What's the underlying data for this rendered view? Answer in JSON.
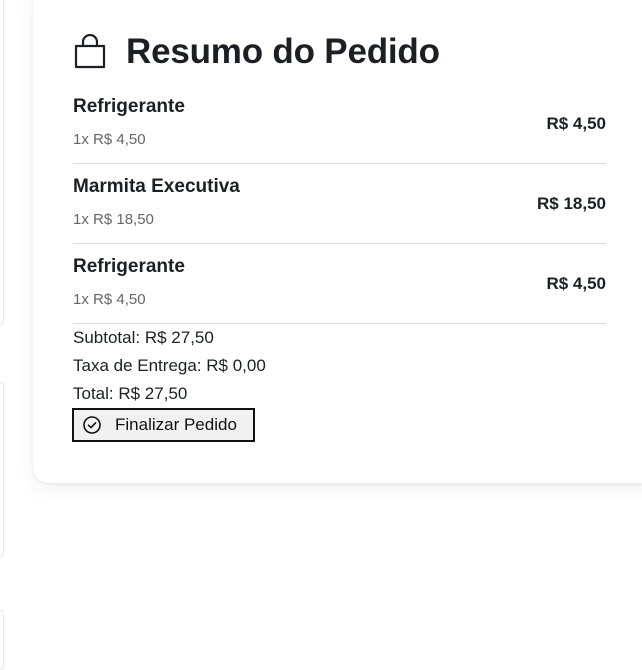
{
  "summary": {
    "title": "Resumo do Pedido",
    "icon": "shopping-bag-icon"
  },
  "items": [
    {
      "name": "Refrigerante",
      "detail": "1x R$ 4,50",
      "price": "R$ 4,50"
    },
    {
      "name": "Marmita Executiva",
      "detail": "1x R$ 18,50",
      "price": "R$ 18,50"
    },
    {
      "name": "Refrigerante",
      "detail": "1x R$ 4,50",
      "price": "R$ 4,50"
    }
  ],
  "totals": {
    "subtotal": "Subtotal: R$ 27,50",
    "delivery": "Taxa de Entrega: R$ 0,00",
    "total": "Total: R$ 27,50"
  },
  "finalize_button": {
    "label": "Finalizar Pedido",
    "icon": "check-circle-icon"
  }
}
